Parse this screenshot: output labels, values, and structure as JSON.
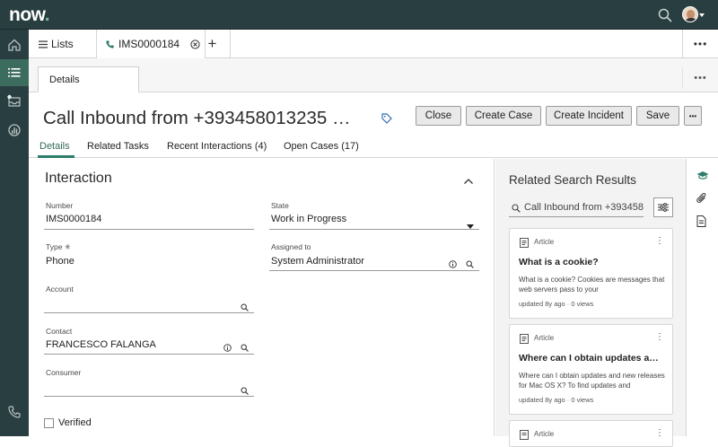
{
  "app": {
    "logo_text": "now",
    "logo_dot": "."
  },
  "topbar": {
    "search_icon": "search-icon",
    "avatar_icon": "user-avatar",
    "caret_icon": "caret-down-icon"
  },
  "leftnav": {
    "items": [
      {
        "name": "home",
        "icon": "home-icon"
      },
      {
        "name": "lists",
        "icon": "list-icon",
        "active": true
      },
      {
        "name": "inbox",
        "icon": "inbox-icon"
      },
      {
        "name": "dashboards",
        "icon": "dashboard-icon"
      },
      {
        "name": "phone",
        "icon": "phone-icon"
      }
    ]
  },
  "tabs": {
    "lists_label": "Lists",
    "record_label": "IMS0000184",
    "more_label": "•••"
  },
  "subbar": {
    "details_label": "Details",
    "more_label": "•••"
  },
  "record": {
    "title": "Call Inbound from +393458013235 …",
    "buttons": {
      "close": "Close",
      "create_case": "Create Case",
      "create_incident": "Create Incident",
      "save": "Save",
      "more": "•••"
    },
    "tabs": [
      "Details",
      "Related Tasks",
      "Recent Interactions (4)",
      "Open Cases (17)"
    ]
  },
  "form": {
    "section_title": "Interaction",
    "number": {
      "label": "Number",
      "value": "IMS0000184"
    },
    "state": {
      "label": "State",
      "value": "Work in Progress"
    },
    "type": {
      "label": "Type ✳",
      "value": "Phone"
    },
    "assigned_to": {
      "label": "Assigned to",
      "value": "System Administrator"
    },
    "account": {
      "label": "Account",
      "value": ""
    },
    "contact": {
      "label": "Contact",
      "value": "FRANCESCO FALANGA"
    },
    "consumer": {
      "label": "Consumer",
      "value": ""
    },
    "verified": {
      "label": "Verified",
      "checked": false
    }
  },
  "related": {
    "title": "Related Search Results",
    "search_value": "Call Inbound from +393458",
    "cards": [
      {
        "type": "Article",
        "title": "What is a cookie?",
        "desc": "What is a cookie? Cookies are messages that web servers pass to your",
        "meta": "updated 8y ago · 0 views"
      },
      {
        "type": "Article",
        "title": "Where can I obtain updates a…",
        "desc": "Where can I obtain updates and new releases for Mac OS X? To find updates and",
        "meta": "updated 8y ago · 0 views"
      },
      {
        "type": "Article",
        "title": "",
        "desc": "",
        "meta": ""
      }
    ]
  },
  "colors": {
    "nav": "#293e40",
    "nav_active": "#3c6c5e",
    "accent": "#2e7d6a"
  }
}
